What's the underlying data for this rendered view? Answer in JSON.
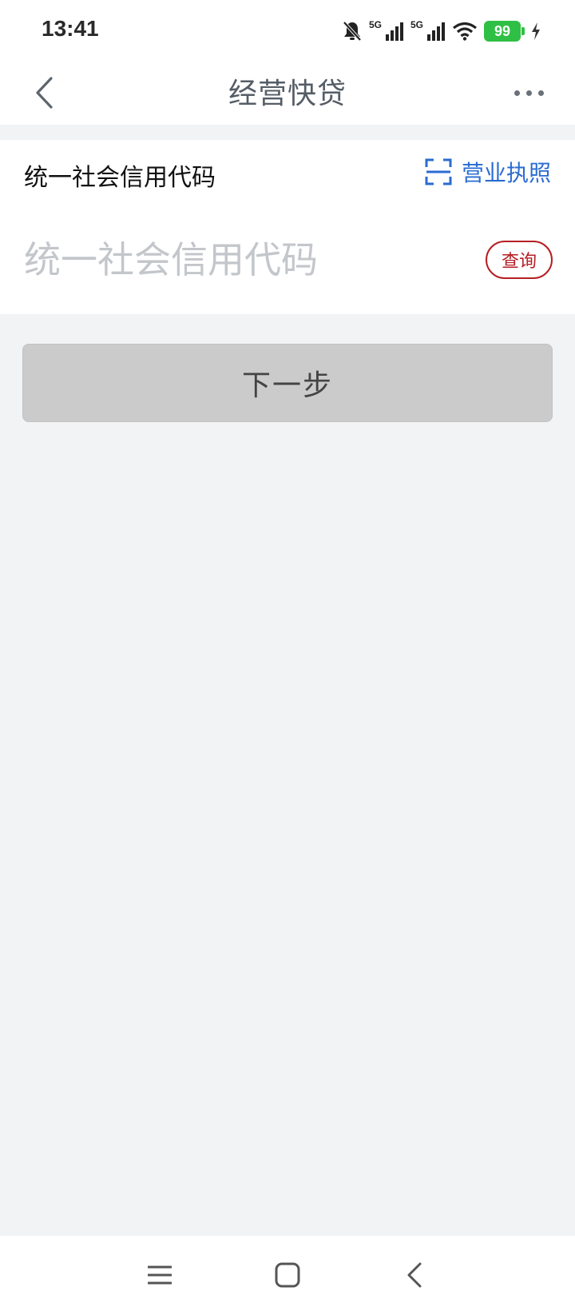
{
  "status_bar": {
    "time": "13:41",
    "network_1": "5G",
    "network_2": "5G",
    "battery_level": "99",
    "icons": [
      "bell-muted-icon",
      "signal-icon",
      "signal-icon",
      "wifi-icon",
      "battery-icon",
      "charging-icon"
    ]
  },
  "nav": {
    "title": "经营快贷",
    "back_icon": "chevron-left-icon",
    "more_icon": "more-dots-icon"
  },
  "form": {
    "label": "统一社会信用代码",
    "scan_label": "营业执照",
    "scan_icon": "scan-frame-icon",
    "input_value": "",
    "input_placeholder": "统一社会信用代码",
    "query_label": "查询"
  },
  "actions": {
    "next_label": "下一步"
  },
  "system_nav": {
    "icons": [
      "menu-icon",
      "home-icon",
      "back-icon"
    ]
  },
  "colors": {
    "accent_blue": "#2a6bd1",
    "query_red": "#b51f24",
    "battery_green": "#2fbf45",
    "button_disabled": "#cbcbcb"
  }
}
